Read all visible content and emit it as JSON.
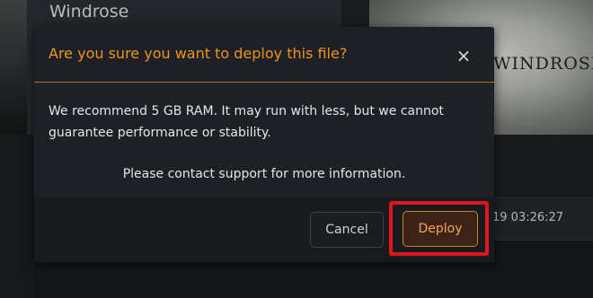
{
  "background": {
    "card_title": "Windrose",
    "banner_logo": "WINDROSE",
    "row_timestamp": "19 03:26:27"
  },
  "modal": {
    "title": "Are you sure you want to deploy this file?",
    "close_icon": "close-icon",
    "close_glyph": "×",
    "body": {
      "line1": "We recommend 5 GB RAM. It may run with less, but we cannot",
      "line2": "guarantee performance or stability.",
      "contact": "Please contact support for more information."
    },
    "buttons": {
      "cancel_label": "Cancel",
      "deploy_label": "Deploy"
    }
  },
  "colors": {
    "accent": "#f1941f",
    "header_divider": "#c46a1a",
    "highlight_outline": "#e3141c",
    "modal_background": "#1d2125"
  }
}
